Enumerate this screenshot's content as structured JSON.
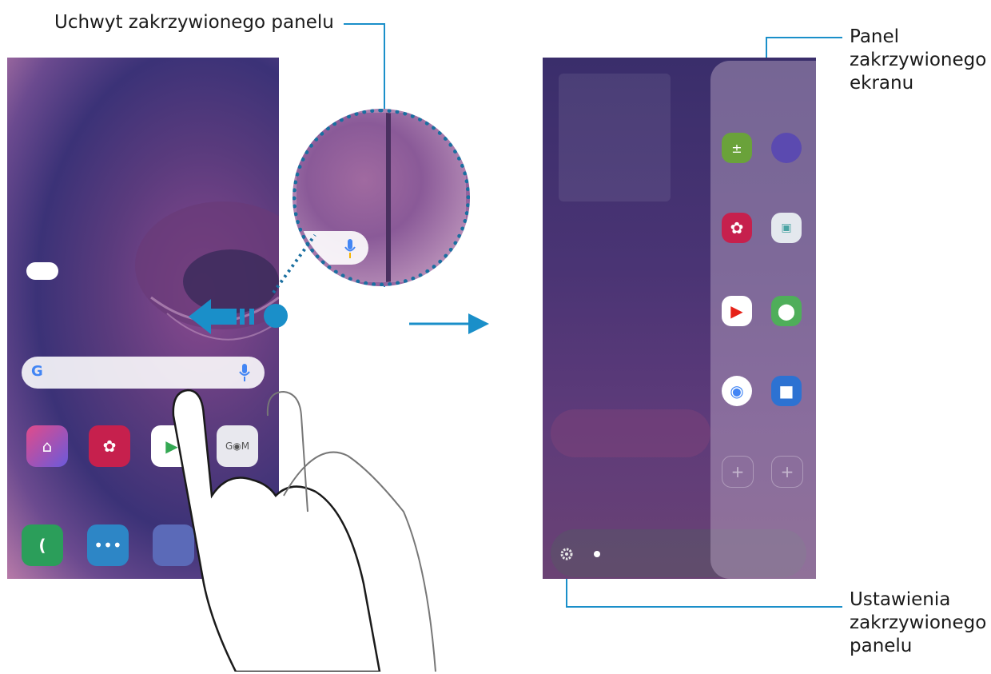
{
  "callouts": {
    "handle_label": "Uchwyt zakrzywionego panelu",
    "panel_label": [
      "Panel",
      "zakrzywionego",
      "ekranu"
    ],
    "settings_label": [
      "Ustawienia",
      "zakrzywionego",
      "panelu"
    ]
  },
  "colors": {
    "accent": "#1a8fc9"
  },
  "icons": [
    "google-g-icon",
    "mic-icon",
    "cloud-icon",
    "calculator-icon",
    "notes-icon",
    "gallery-icon",
    "folder-icon",
    "youtube-icon",
    "maps-icon",
    "chrome-icon",
    "video-icon",
    "gear-icon",
    "phone-icon",
    "messages-icon",
    "store-icon",
    "play-store-icon",
    "swipe-left-arrow-icon",
    "hand-icon"
  ]
}
